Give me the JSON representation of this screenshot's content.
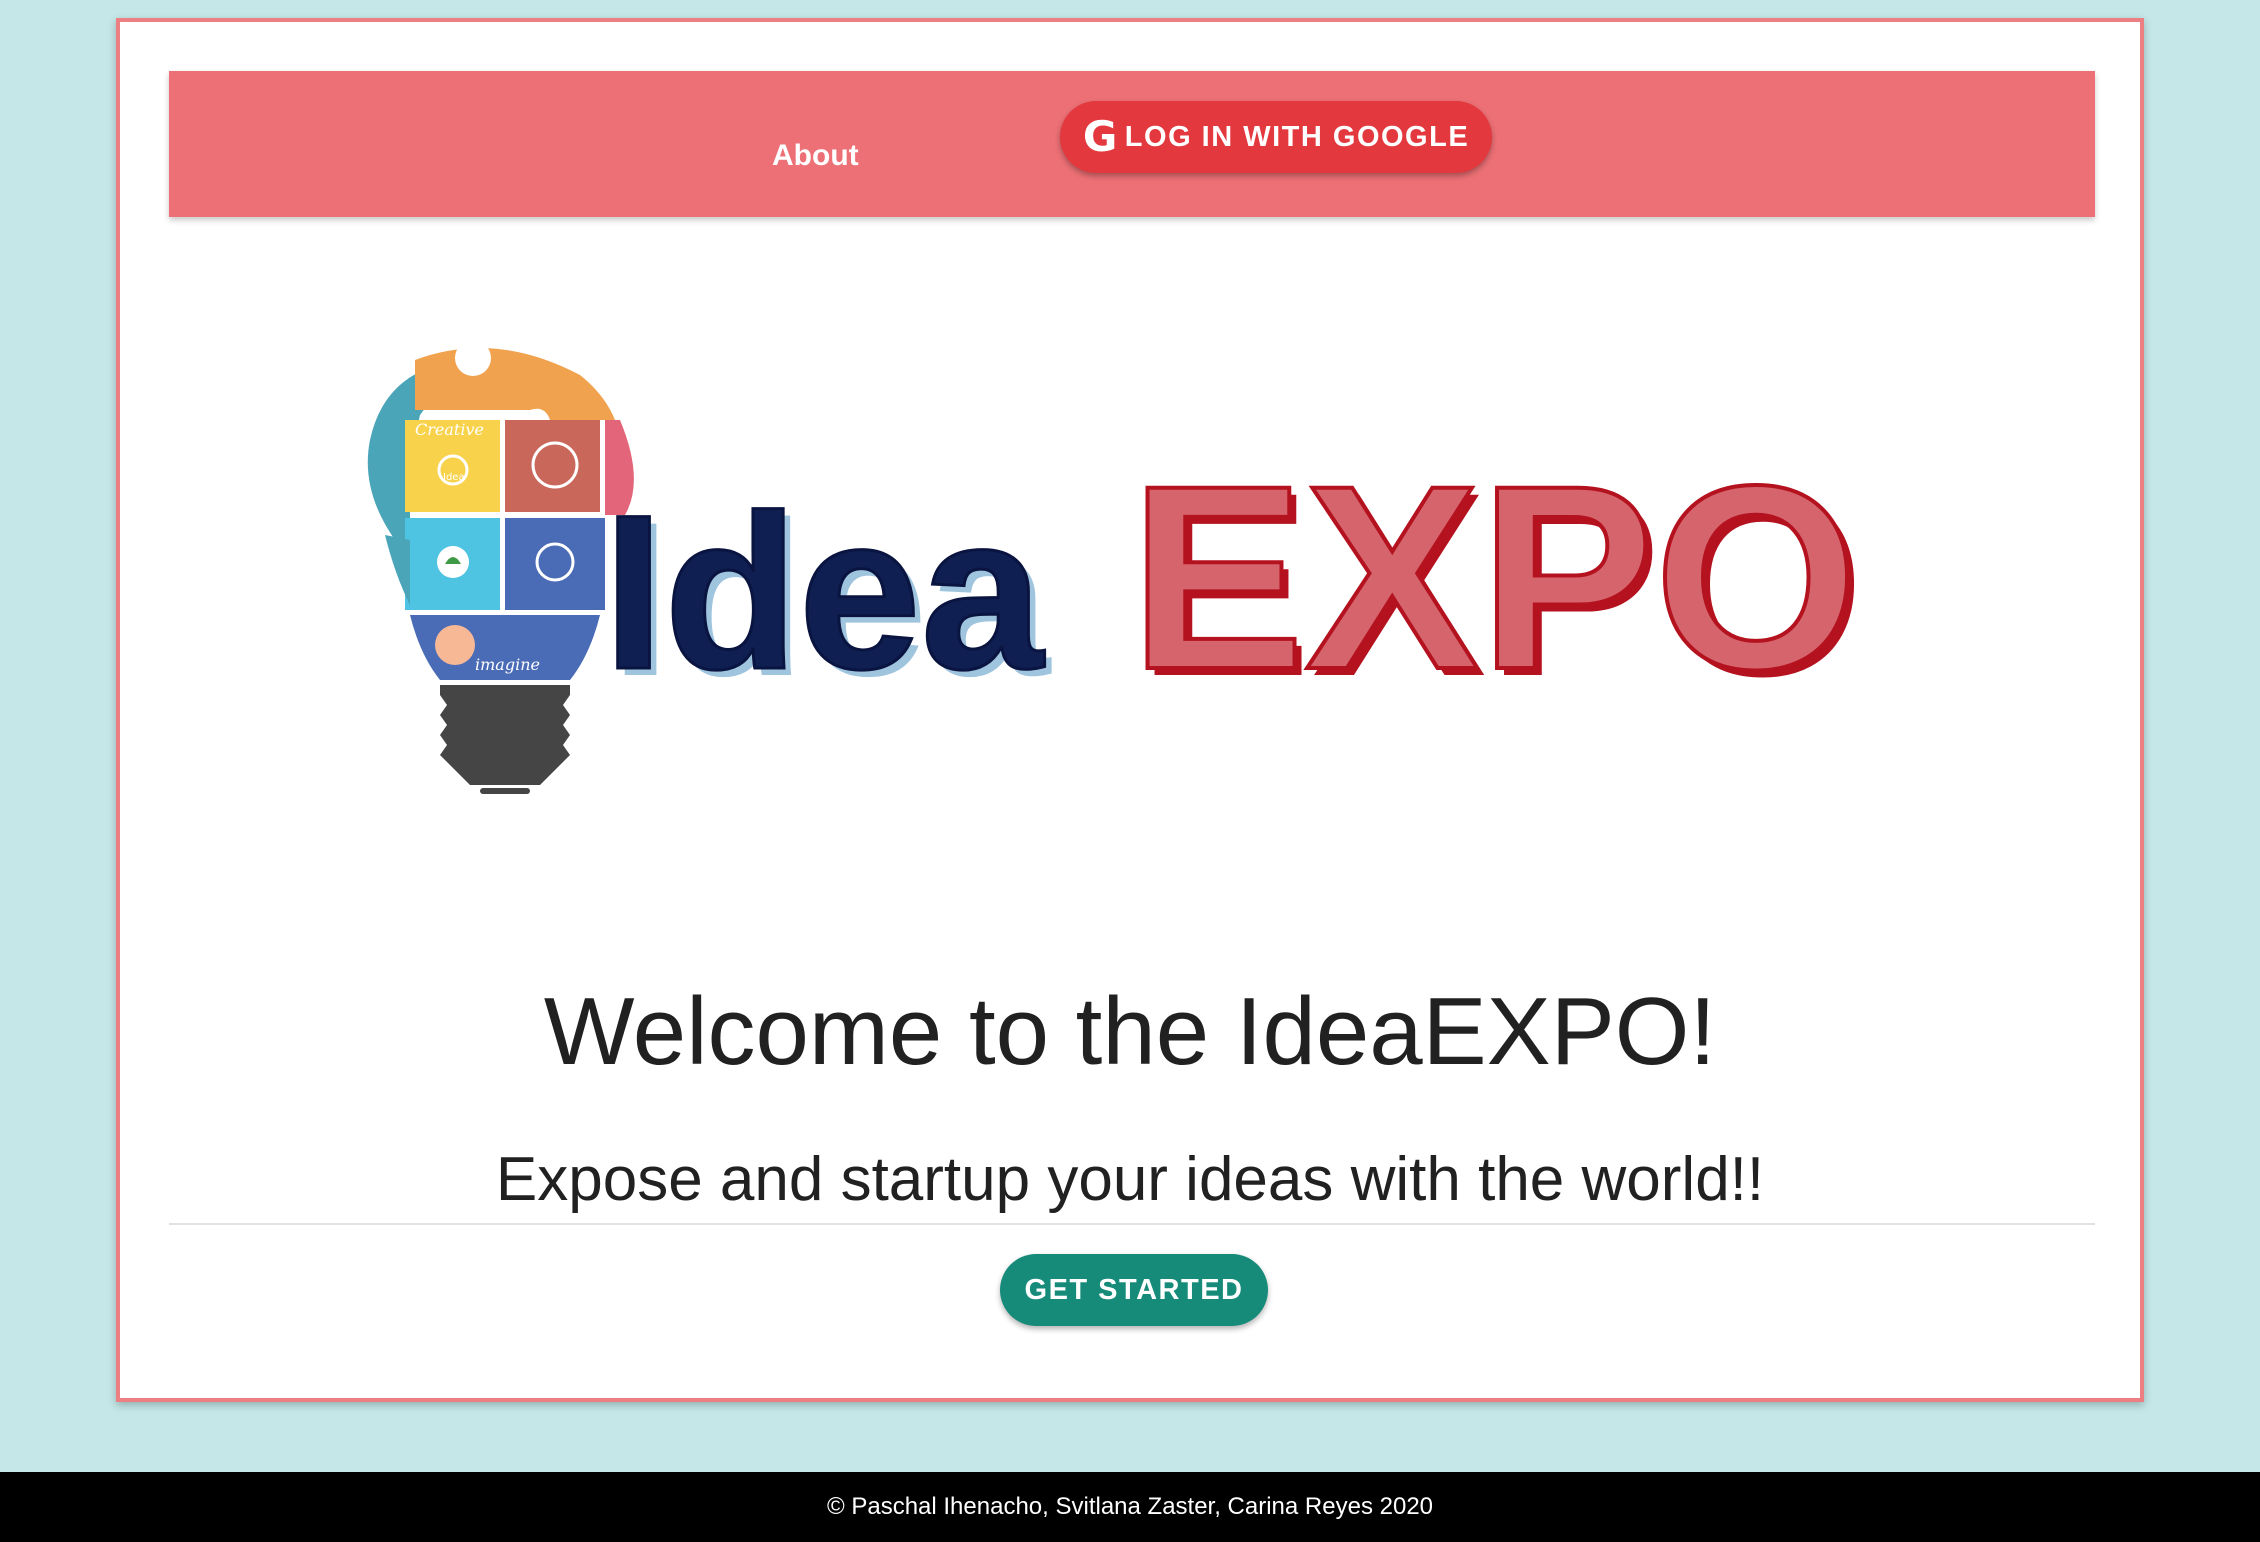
{
  "navbar": {
    "about_label": "About",
    "google_login_label": "LOG IN WITH GOOGLE",
    "google_icon": "G"
  },
  "logo": {
    "part1": "Idea",
    "part2": "EXPO",
    "bulb_top_label": "Creative",
    "bulb_idea_label": "Idea",
    "bulb_bottom_label": "imagine"
  },
  "hero": {
    "title": "Welcome to the IdeaEXPO!",
    "subtitle": "Expose and startup your ideas with the world!!",
    "cta_label": "GET STARTED"
  },
  "footer": {
    "copyright": "© Paschal Ihenacho, Svitlana Zaster, Carina Reyes 2020"
  },
  "colors": {
    "page_bg": "#c5e7e8",
    "card_border": "#ec7f82",
    "navbar_bg": "#ec7075",
    "google_btn": "#e3383d",
    "cta_btn": "#168b7a",
    "logo_idea": "#0f1f52",
    "logo_expo_fill": "#d5646d",
    "logo_expo_stroke": "#b5121f",
    "footer_bg": "#000000"
  }
}
